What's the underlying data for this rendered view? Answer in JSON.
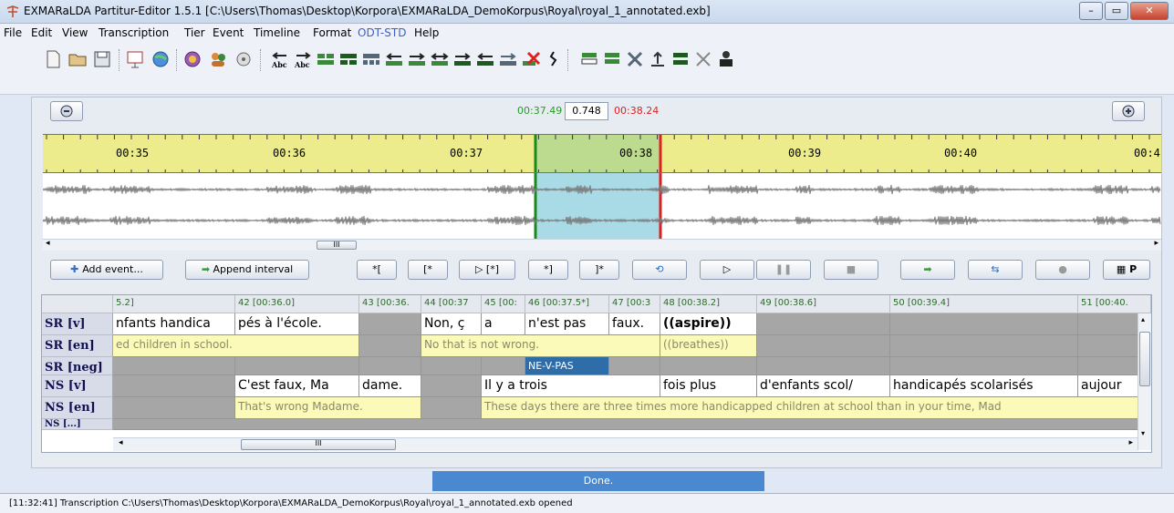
{
  "window": {
    "title": "EXMARaLDA Partitur-Editor 1.5.1 [C:\\Users\\Thomas\\Desktop\\Korpora\\EXMARaLDA_DemoKorpus\\Royal\\royal_1_annotated.exb]",
    "minimize_icon": "minimize-icon",
    "maximize_icon": "maximize-icon",
    "close_icon": "close-icon"
  },
  "menu": [
    "File",
    "Edit",
    "View",
    "Transcription",
    "Tier",
    "Event",
    "Timeline",
    "Format",
    "ODT-STD",
    "Help"
  ],
  "player": {
    "start_time": "00:37.49",
    "duration": "0.748",
    "end_time": "00:38.24"
  },
  "timeline": {
    "labels": [
      "00:35",
      "00:36",
      "00:37",
      "00:38",
      "00:39",
      "00:40",
      "00:4"
    ]
  },
  "controls": {
    "add_event": "Add event...",
    "append_interval": "Append interval",
    "b1": "*[",
    "b2": "[*",
    "b3": "▷ [*]",
    "b4": "*]",
    "b5": "]*",
    "b6": "▷",
    "p_label": "P"
  },
  "grid": {
    "columns": [
      "5.2]",
      "42 [00:36.0]",
      "43 [00:36.",
      "44 [00:37",
      "45 [00:",
      "46 [00:37.5*]",
      "47 [00:3",
      "48 [00:38.2]",
      "49 [00:38.6]",
      "50 [00:39.4]",
      "51 [00:40."
    ],
    "tiers": [
      "SR [v]",
      "SR [en]",
      "SR [neg]",
      "NS [v]",
      "NS [en]",
      "NS [...]"
    ],
    "sr_v": [
      "nfants handica",
      "pés à l'école.",
      "Non, ç",
      "a",
      "n'est pas",
      "faux.",
      "((aspire))"
    ],
    "sr_en": [
      "ed children in school.",
      "No that is not wrong.",
      "((breathes))"
    ],
    "sr_neg": "NE-V-PAS",
    "ns_v": [
      "C'est faux, Ma",
      "dame.",
      "Il y a trois",
      "fois plus",
      "d'enfants scol/",
      "handicapés scolarisés",
      "aujour"
    ],
    "ns_en": [
      "That's wrong Madame.",
      "These days there are three times more handicapped children at school than in your time, Mad"
    ]
  },
  "progress": "Done.",
  "status": "[11:32:41] Transcription C:\\Users\\Thomas\\Desktop\\Korpora\\EXMARaLDA_DemoKorpus\\Royal\\royal_1_annotated.exb opened"
}
